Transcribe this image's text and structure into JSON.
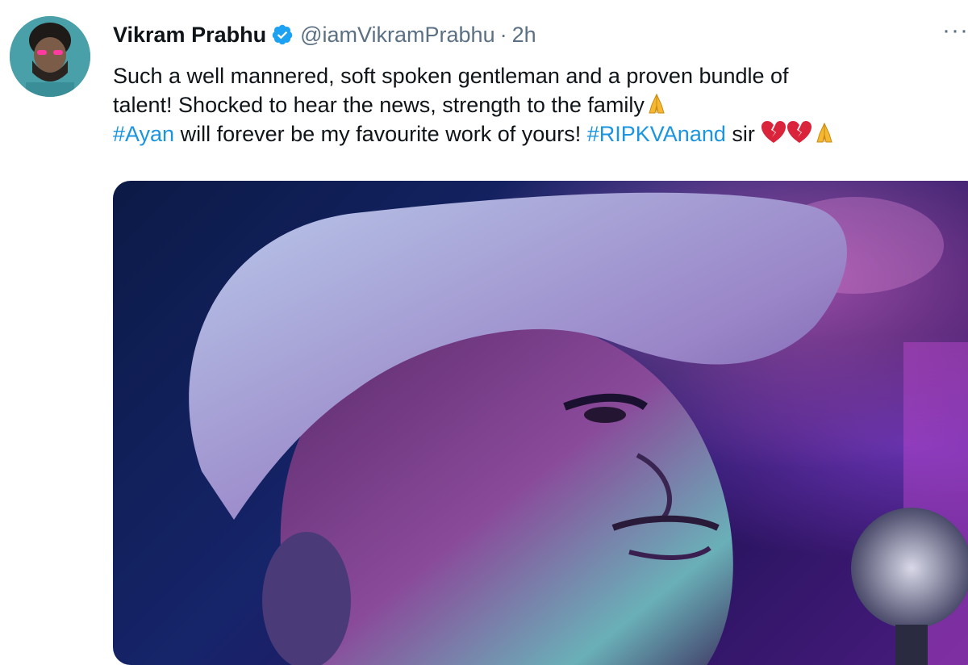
{
  "tweet": {
    "display_name": "Vikram Prabhu",
    "handle": "@iamVikramPrabhu",
    "separator": "·",
    "time": "2h",
    "more_label": "···",
    "line1": "Such a well mannered, soft spoken gentleman and a proven bundle of",
    "line2": "talent! Shocked to hear the news, strength to the family",
    "hashtag1": "#Ayan",
    "line3_mid": " will forever be my favourite work of yours! ",
    "hashtag2": "#RIPKVAnand",
    "line3_end": " sir ",
    "icons": [
      "verified-badge-icon",
      "folded-hands-emoji",
      "broken-heart-emoji"
    ],
    "colors": {
      "hashtag": "#1b95e0",
      "verified": "#1da1f2",
      "muted": "#5b7083"
    }
  }
}
